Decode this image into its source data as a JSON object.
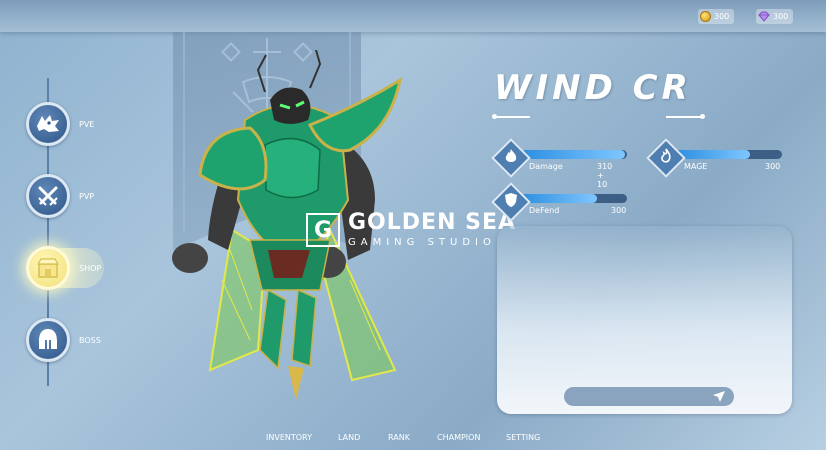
{
  "currency": {
    "gold": "300",
    "gem": "300"
  },
  "nav": {
    "items": [
      {
        "label": "PVE",
        "icon": "wolf-skull-icon"
      },
      {
        "label": "PVP",
        "icon": "crossed-swords-icon"
      },
      {
        "label": "SHOP",
        "icon": "shop-icon"
      },
      {
        "label": "BOSS",
        "icon": "spartan-helmet-icon"
      }
    ],
    "active": "SHOP"
  },
  "hero": {
    "name": "WIND CR"
  },
  "watermark": {
    "mark": "G",
    "title": "GOLDEN SEA",
    "subtitle": "GAMING STUDIO"
  },
  "stats": {
    "damage": {
      "label": "Damage",
      "value": "310 + 10",
      "level": 0.98
    },
    "mage": {
      "label": "MAGE",
      "value": "300",
      "level": 0.7
    },
    "defend": {
      "label": "DeFend",
      "value": "300",
      "level": 0.72
    }
  },
  "bottom_menu": [
    "INVENTORY",
    "LAND",
    "RANK",
    "CHAMPION",
    "SETTING"
  ],
  "colors": {
    "bar_fill": "#4aa6f0",
    "nav_circle": "#3a6496",
    "shop_glow": "#fff7b8",
    "armor_green": "#1f9a6a"
  }
}
